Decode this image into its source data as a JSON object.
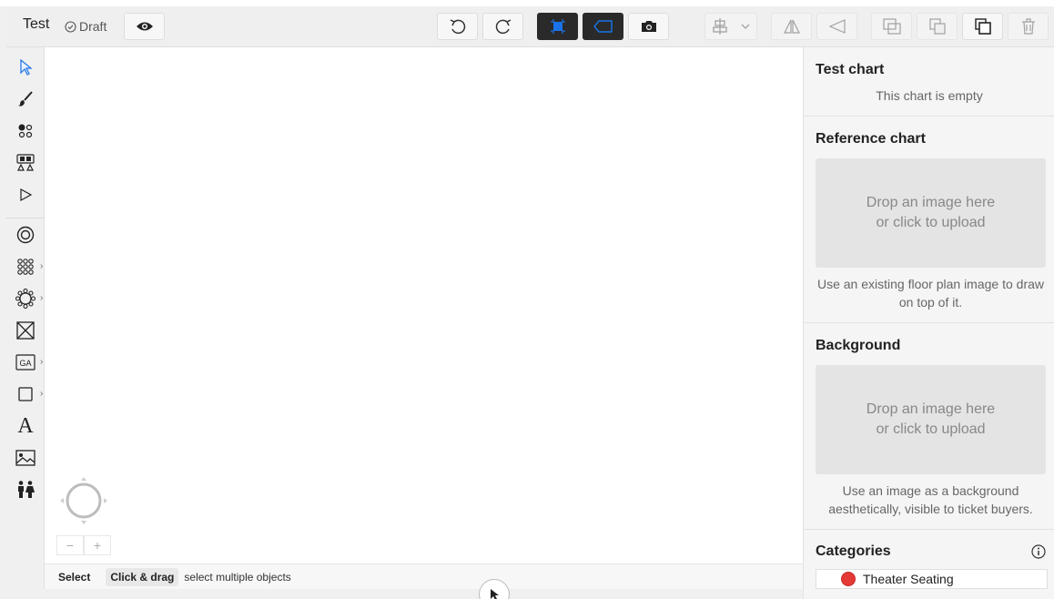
{
  "toolbar": {
    "title": "Test",
    "status": "Draft",
    "icons": [
      "check-circle-icon",
      "eye-icon",
      "undo-icon",
      "redo-icon",
      "snap-icon",
      "tag-icon",
      "camera-icon",
      "align-icon",
      "chevron-down-icon",
      "flip-horizontal-icon",
      "flip-vertical-icon",
      "group-icon",
      "ungroup-icon",
      "copy-icon",
      "paste-icon",
      "trash-icon"
    ]
  },
  "left_tools": {
    "items": [
      {
        "icon": "cursor-arrow-icon"
      },
      {
        "icon": "brush-icon"
      },
      {
        "icon": "node-select-icon"
      },
      {
        "icon": "shape-select-icon"
      },
      {
        "icon": "focal-point-icon"
      },
      {
        "icon": "round-table-icon"
      },
      {
        "icon": "seat-grid-icon",
        "expand": true
      },
      {
        "icon": "booth-icon",
        "expand": true
      },
      {
        "icon": "box-x-icon"
      },
      {
        "icon": "ga-area-icon",
        "label": "GA",
        "expand": true
      },
      {
        "icon": "rectangle-icon",
        "expand": true
      },
      {
        "icon": "text-icon",
        "label": "A"
      },
      {
        "icon": "image-icon"
      },
      {
        "icon": "restroom-icon"
      }
    ]
  },
  "canvas": {
    "zoom_out": "−",
    "zoom_in": "+"
  },
  "statusbar": {
    "mode": "Select",
    "shortcut": "Click & drag",
    "description": "select multiple objects"
  },
  "panel": {
    "chart_title": "Test chart",
    "chart_empty": "This chart is empty",
    "reference_title": "Reference chart",
    "reference_drop_line1": "Drop an image here",
    "reference_drop_line2": "or click to upload",
    "reference_hint": "Use an existing floor plan image to draw on top of it.",
    "background_title": "Background",
    "background_drop_line1": "Drop an image here",
    "background_drop_line2": "or click to upload",
    "background_hint": "Use an image as a background aesthetically, visible to ticket buyers.",
    "categories_title": "Categories",
    "categories": [
      {
        "name": "Theater Seating",
        "color": "#e53935"
      }
    ]
  },
  "colors": {
    "accent": "#1a73e8",
    "dark_button": "#2a2a2a",
    "category_red": "#e53935"
  }
}
